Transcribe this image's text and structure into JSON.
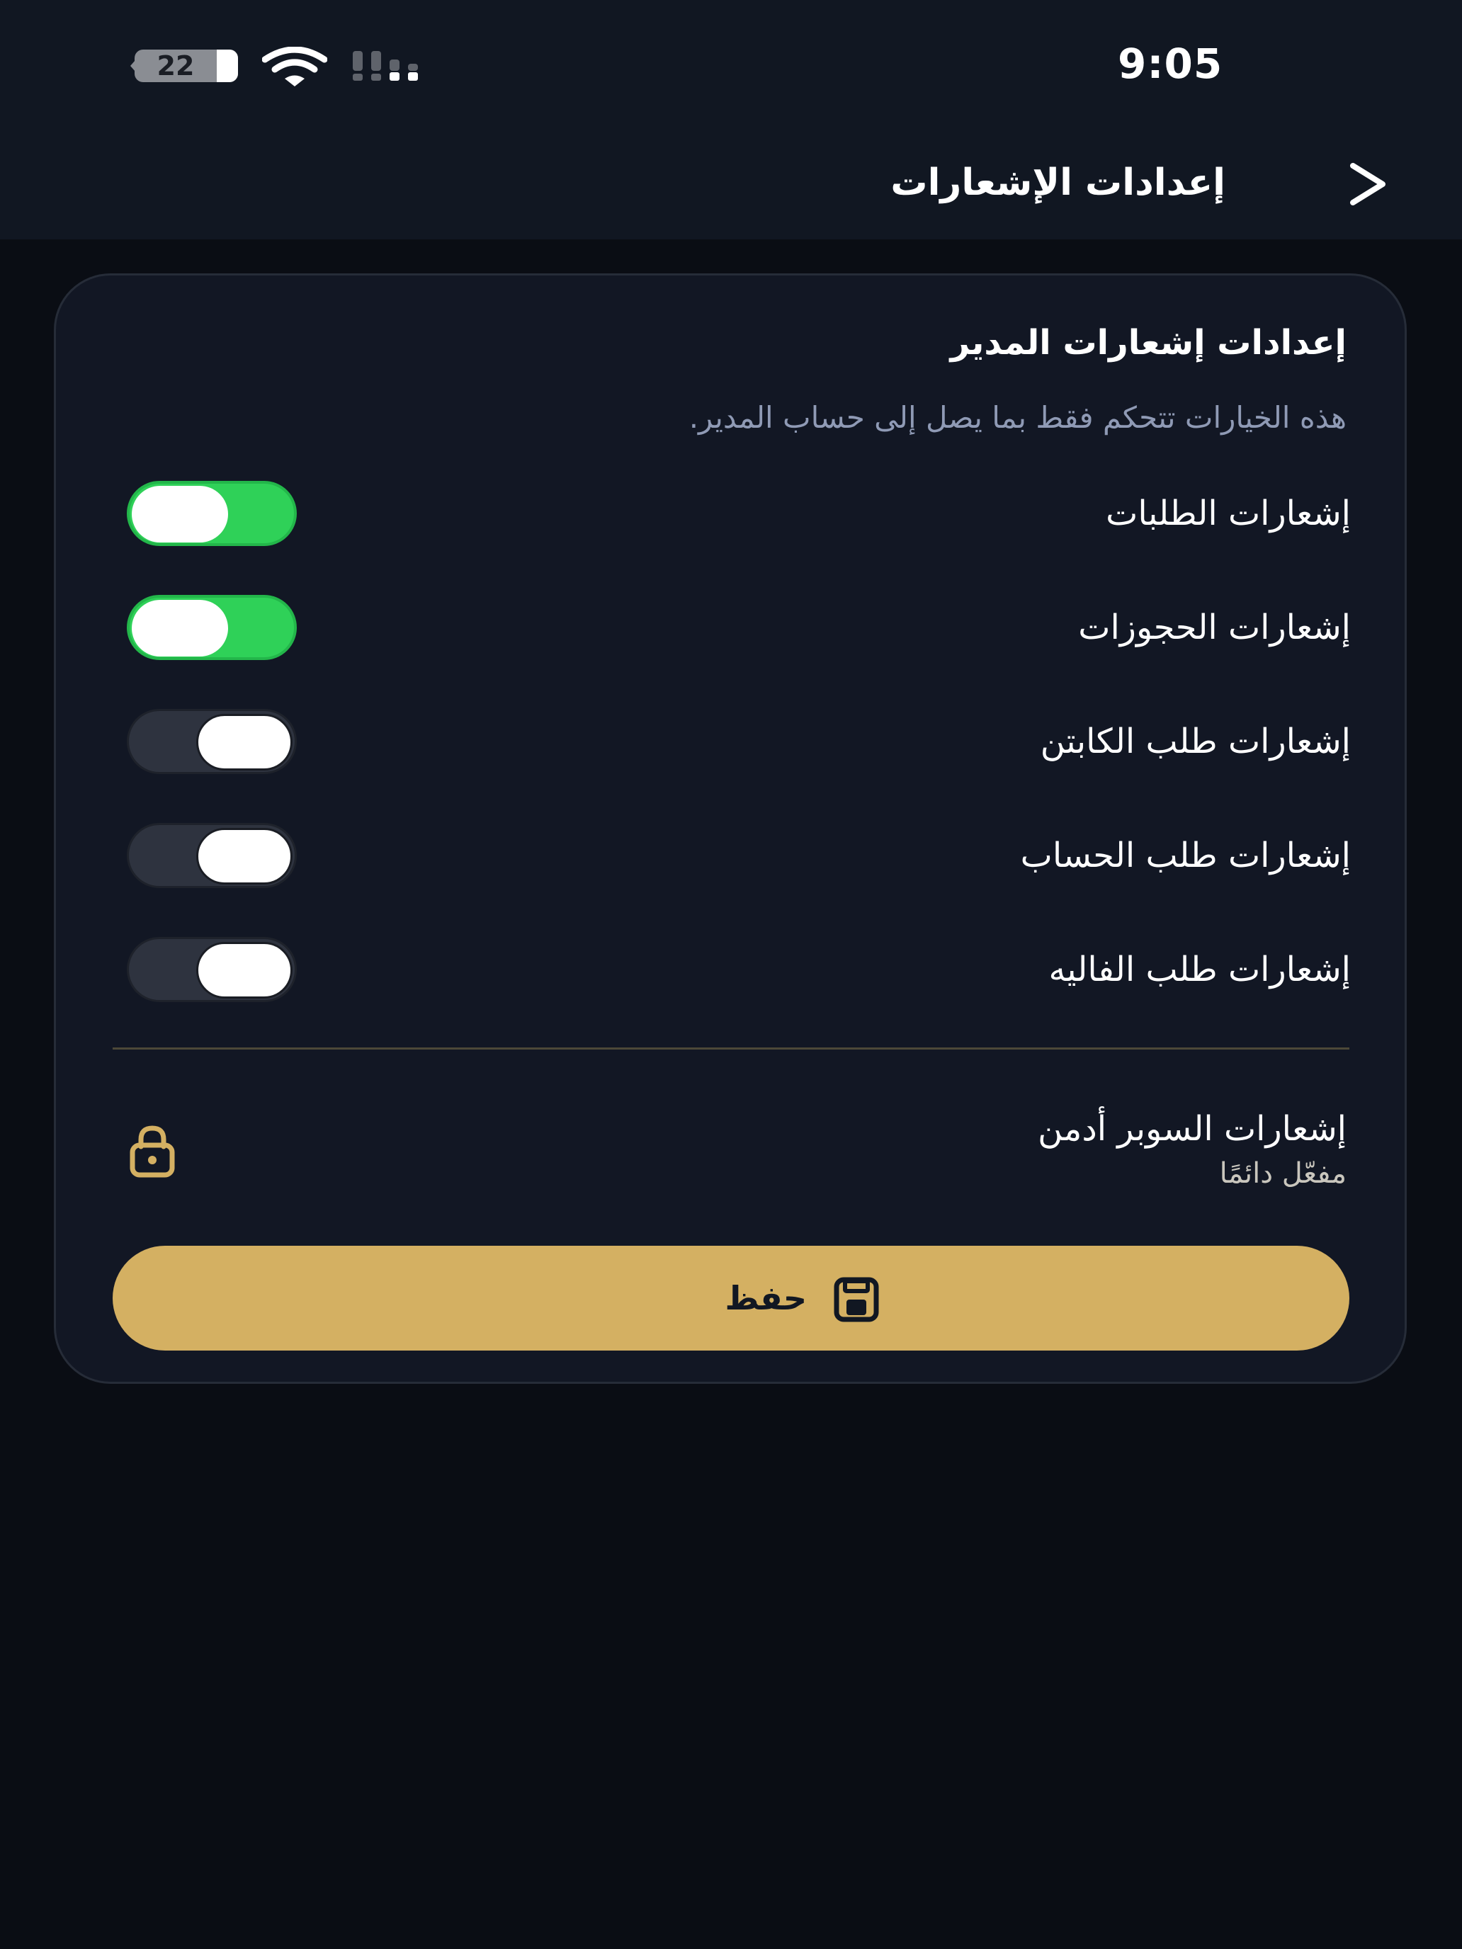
{
  "status_bar": {
    "time": "9:05",
    "battery_level": "22"
  },
  "header": {
    "title": "إعدادات الإشعارات",
    "back_icon": "chevron-right-icon"
  },
  "card": {
    "title": "إعدادات إشعارات المدير",
    "description": "هذه الخيارات تتحكم فقط بما يصل إلى حساب المدير.",
    "toggles": [
      {
        "label": "إشعارات الطلبات",
        "enabled": true
      },
      {
        "label": "إشعارات الحجوزات",
        "enabled": true
      },
      {
        "label": "إشعارات طلب الكابتن",
        "enabled": false
      },
      {
        "label": "إشعارات طلب الحساب",
        "enabled": false
      },
      {
        "label": "إشعارات طلب الفاليه",
        "enabled": false
      }
    ],
    "super_admin": {
      "title": "إشعارات السوبر أدمن",
      "subtitle": "مفعّل دائمًا",
      "icon": "lock-icon"
    },
    "save_button": {
      "label": "حفظ",
      "icon": "save-icon"
    }
  },
  "colors": {
    "toggle_on": "#2fd158",
    "accent_gold": "#d4b062",
    "background": "#0a0d14",
    "card": "#121724"
  }
}
